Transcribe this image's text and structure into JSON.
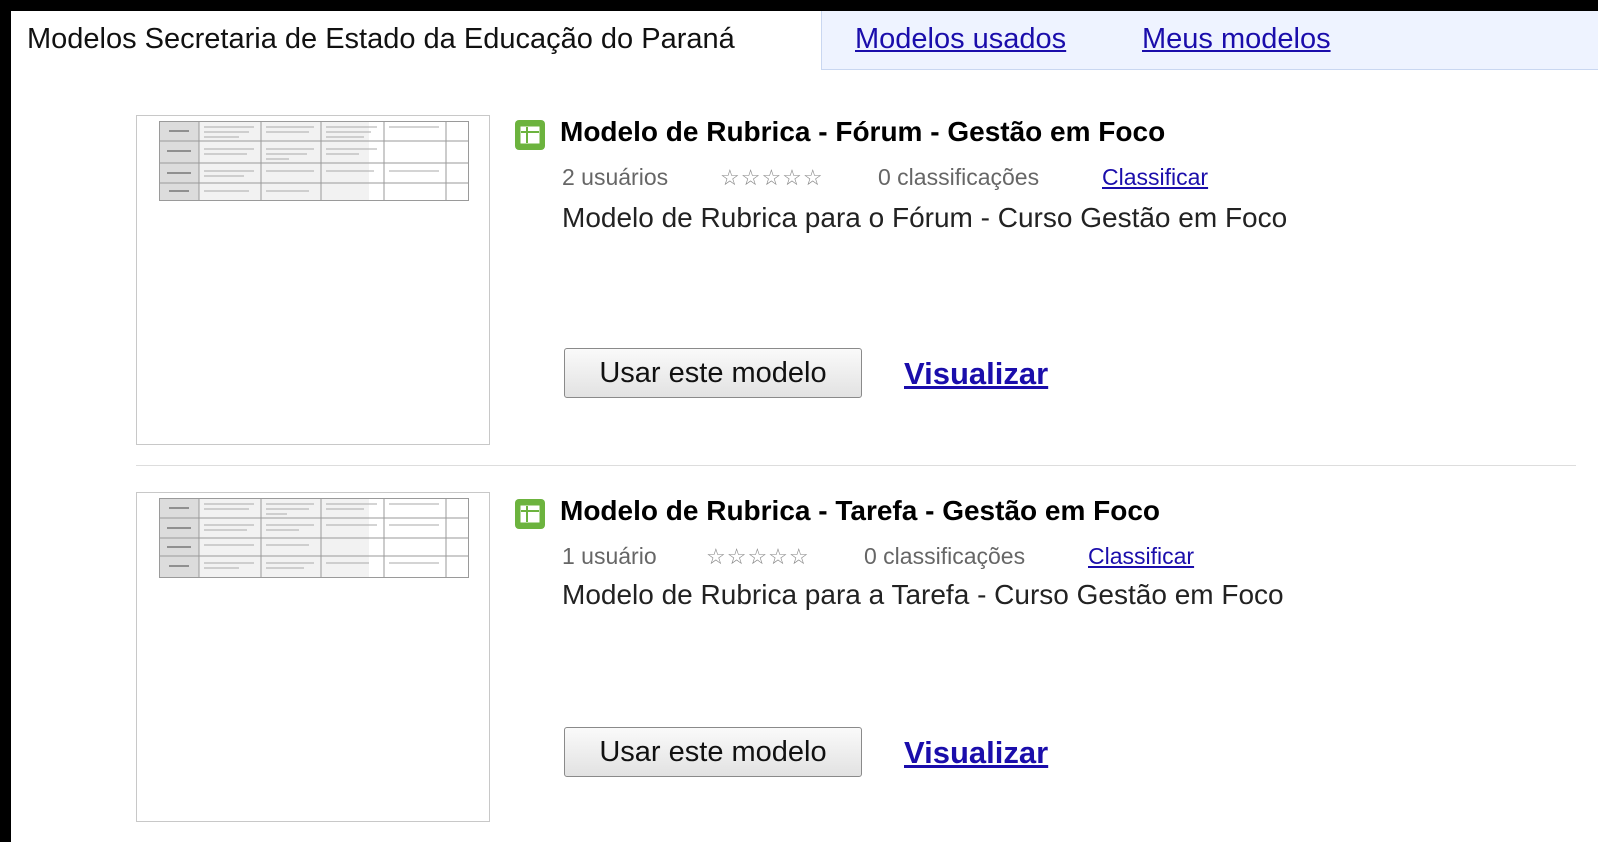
{
  "tabs": {
    "active": "Modelos Secretaria de Estado da Educação do Paraná",
    "used": "Modelos usados",
    "mine": "Meus modelos"
  },
  "templates": [
    {
      "title": "Modelo de Rubrica - Fórum - Gestão em Foco",
      "users": "2 usuários",
      "stars": "☆☆☆☆☆",
      "ratings": "0 classificações",
      "rate_label": "Classificar",
      "description": "Modelo de Rubrica para o Fórum - Curso Gestão em Foco",
      "use_label": "Usar este modelo",
      "view_label": "Visualizar"
    },
    {
      "title": "Modelo de Rubrica - Tarefa - Gestão em Foco",
      "users": "1 usuário",
      "stars": "☆☆☆☆☆",
      "ratings": "0 classificações",
      "rate_label": "Classificar",
      "description": "Modelo de Rubrica para a Tarefa - Curso Gestão em Foco",
      "use_label": "Usar este modelo",
      "view_label": "Visualizar"
    }
  ],
  "icons": {
    "template_type": "spreadsheet-icon"
  },
  "colors": {
    "link": "#1a0dab",
    "tab_bar": "#eef3ff",
    "icon": "#6cb33e"
  }
}
